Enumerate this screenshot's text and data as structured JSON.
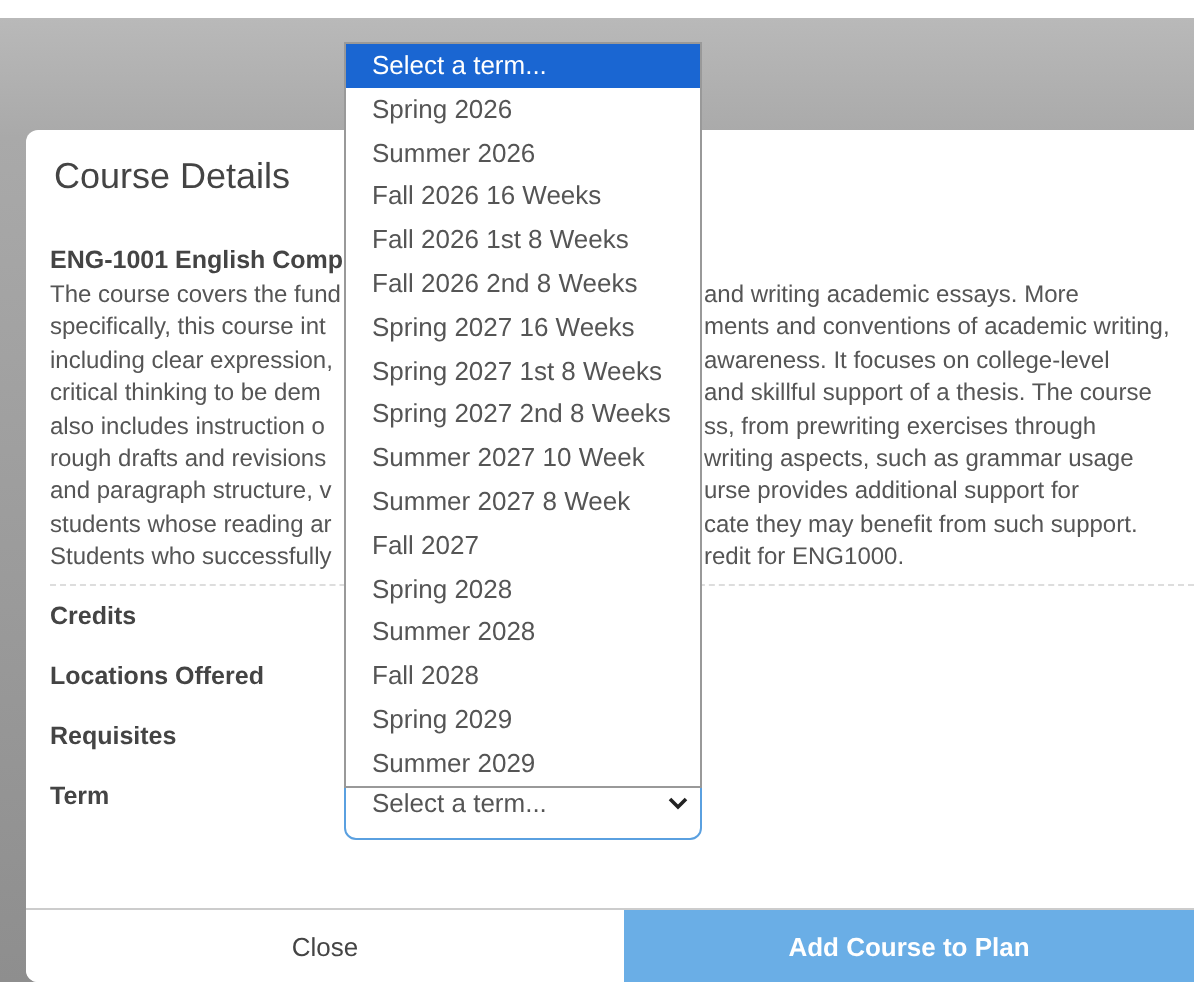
{
  "modal": {
    "title": "Course Details",
    "course_title": "ENG-1001 English Comp",
    "description_lines": [
      {
        "left": "The course covers the fund",
        "right": "and writing academic essays. More"
      },
      {
        "left": "specifically, this course int",
        "right": "ments and conventions of academic writing,"
      },
      {
        "left": "including clear expression,",
        "right": "awareness. It focuses on college-level"
      },
      {
        "left": "critical thinking to be dem",
        "right": "and skillful support of a thesis. The course"
      },
      {
        "left": "also includes instruction o",
        "right": "ss, from prewriting exercises through"
      },
      {
        "left": "rough drafts and revisions",
        "right": "writing aspects, such as grammar usage"
      },
      {
        "left": "and paragraph structure, v",
        "right": "urse provides additional support for"
      },
      {
        "left": "students whose reading ar",
        "right": "cate they may benefit from such support."
      },
      {
        "left": "Students who successfully",
        "right": "redit for ENG1000."
      }
    ],
    "fields": [
      {
        "label": "Credits"
      },
      {
        "label": "Locations Offered"
      },
      {
        "label": "Requisites"
      },
      {
        "label": "Term"
      }
    ],
    "term_select": {
      "value": "Select a term...",
      "expanded": true,
      "options": [
        {
          "label": "Select a term...",
          "selected": true
        },
        {
          "label": "Spring 2026",
          "selected": false
        },
        {
          "label": "Summer 2026",
          "selected": false
        },
        {
          "label": "Fall 2026 16 Weeks",
          "selected": false
        },
        {
          "label": "Fall 2026 1st 8 Weeks",
          "selected": false
        },
        {
          "label": "Fall 2026 2nd 8 Weeks",
          "selected": false
        },
        {
          "label": "Spring 2027 16 Weeks",
          "selected": false
        },
        {
          "label": "Spring 2027 1st 8 Weeks",
          "selected": false
        },
        {
          "label": "Spring 2027 2nd 8 Weeks",
          "selected": false
        },
        {
          "label": "Summer 2027 10 Week",
          "selected": false
        },
        {
          "label": "Summer 2027 8 Week",
          "selected": false
        },
        {
          "label": "Fall 2027",
          "selected": false
        },
        {
          "label": "Spring 2028",
          "selected": false
        },
        {
          "label": "Summer 2028",
          "selected": false
        },
        {
          "label": "Fall 2028",
          "selected": false
        },
        {
          "label": "Spring 2029",
          "selected": false
        },
        {
          "label": "Summer 2029",
          "selected": false
        }
      ]
    },
    "buttons": [
      {
        "label": "Close",
        "kind": "secondary"
      },
      {
        "label": "Add Course to Plan",
        "kind": "primary"
      }
    ]
  }
}
